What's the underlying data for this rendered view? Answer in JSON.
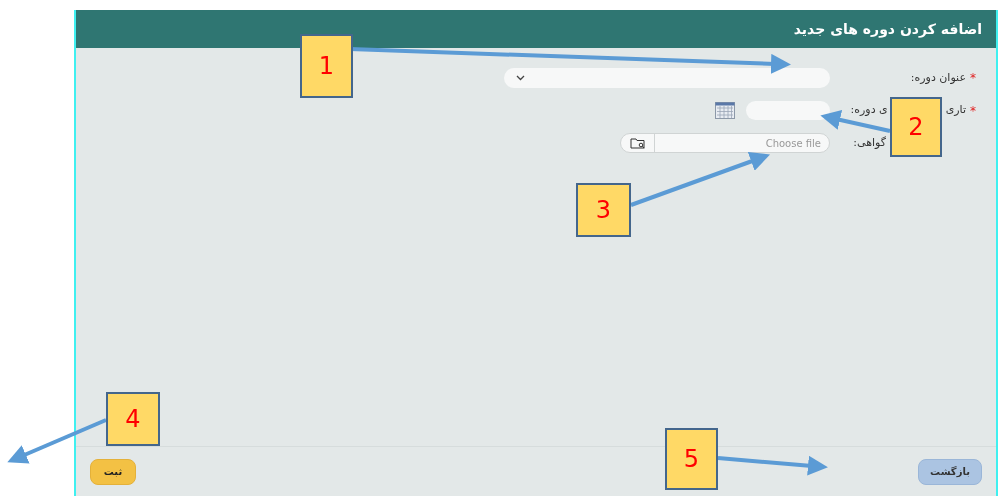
{
  "dialog": {
    "title": "اضافه کردن دوره های جدید"
  },
  "fields": [
    {
      "kind": "select",
      "required_mark": "*",
      "label_parts": [
        "عنوان دوره:"
      ]
    },
    {
      "kind": "date",
      "required_mark": "*",
      "label_parts": [
        "تاری",
        "ی دوره:"
      ]
    },
    {
      "kind": "file",
      "label_parts": [
        "گواهی:"
      ],
      "placeholder": "Choose file"
    }
  ],
  "buttons": [
    {
      "kind": "back",
      "label": "بازگشت"
    },
    {
      "kind": "submit",
      "label": "ثبت"
    }
  ],
  "annotations": [
    {
      "label": "1"
    },
    {
      "label": "2"
    },
    {
      "label": "3"
    },
    {
      "label": "4"
    },
    {
      "label": "5"
    }
  ]
}
